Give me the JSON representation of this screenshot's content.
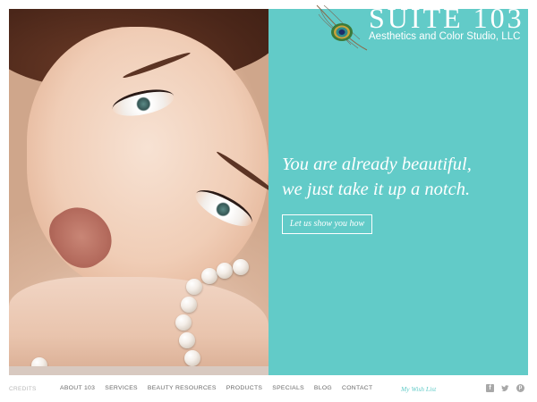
{
  "brand": {
    "name": "SUITE 103",
    "tagline": "Aesthetics and Color Studio, LLC",
    "logo_icon": "peacock-feather-icon",
    "accent_color": "#62cbc8"
  },
  "hero": {
    "headline_line1": "You are already beautiful,",
    "headline_line2": "we just take it up a notch.",
    "cta_label": "Let us show you how"
  },
  "footer": {
    "credits_label": "CREDITS",
    "nav": [
      "ABOUT 103",
      "SERVICES",
      "BEAUTY RESOURCES",
      "PRODUCTS",
      "SPECIALS",
      "BLOG",
      "CONTACT"
    ],
    "wishlist_label": "My Wish List",
    "social_icons": [
      "facebook-icon",
      "twitter-icon",
      "pinterest-icon"
    ]
  }
}
